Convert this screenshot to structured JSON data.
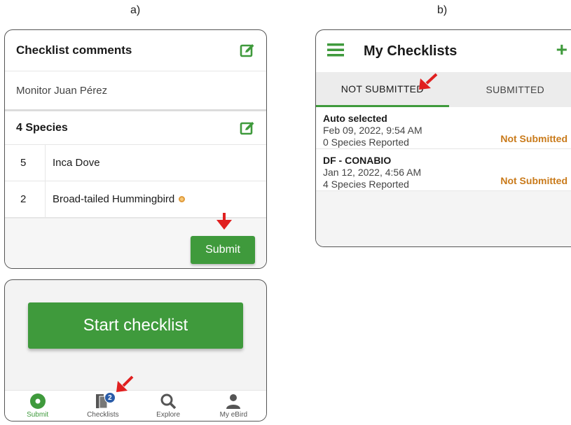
{
  "labels": {
    "a": "a)",
    "b": "b)"
  },
  "panel_a": {
    "comments_title": "Checklist comments",
    "comment_text": "Monitor Juan Pérez",
    "species_title": "4 Species",
    "species": [
      {
        "count": "5",
        "name": "Inca Dove",
        "rare": false
      },
      {
        "count": "2",
        "name": "Broad-tailed Hummingbird",
        "rare": true
      }
    ],
    "submit_label": "Submit",
    "start_label": "Start checklist",
    "nav": [
      {
        "label": "Submit",
        "icon": "submit-dot-icon",
        "active": true
      },
      {
        "label": "Checklists",
        "icon": "checklists-icon",
        "badge": "2"
      },
      {
        "label": "Explore",
        "icon": "search-icon"
      },
      {
        "label": "My eBird",
        "icon": "person-icon"
      }
    ]
  },
  "panel_b": {
    "title": "My Checklists",
    "tabs": [
      {
        "label": "NOT SUBMITTED",
        "active": true
      },
      {
        "label": "SUBMITTED",
        "active": false
      }
    ],
    "checklists": [
      {
        "name": "Auto selected",
        "date": "Feb 09, 2022, 9:54 AM",
        "count": "0 Species Reported",
        "status": "Not Submitted"
      },
      {
        "name": "DF - CONABIO",
        "date": "Jan 12, 2022, 4:56 AM",
        "count": "4 Species Reported",
        "status": "Not Submitted"
      }
    ]
  },
  "colors": {
    "accent": "#3f9a3c",
    "status": "#c97a1a",
    "badge": "#2a5ca8",
    "arrow": "#e02020"
  }
}
